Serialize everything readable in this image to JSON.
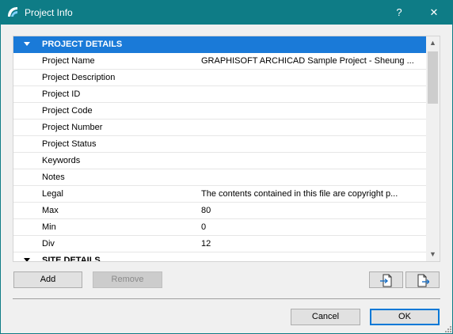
{
  "window": {
    "title": "Project Info",
    "help_label": "?",
    "close_label": "✕",
    "accent_color": "#0e7c86"
  },
  "list": {
    "sections": [
      {
        "title": "PROJECT DETAILS",
        "expanded": true,
        "rows": [
          {
            "key": "Project Name",
            "value": "GRAPHISOFT ARCHICAD Sample Project - Sheung ..."
          },
          {
            "key": "Project Description",
            "value": ""
          },
          {
            "key": "Project ID",
            "value": ""
          },
          {
            "key": "Project Code",
            "value": ""
          },
          {
            "key": "Project Number",
            "value": ""
          },
          {
            "key": "Project Status",
            "value": ""
          },
          {
            "key": "Keywords",
            "value": ""
          },
          {
            "key": "Notes",
            "value": ""
          },
          {
            "key": "Legal",
            "value": "The contents contained in this file are copyright p..."
          },
          {
            "key": "Max",
            "value": "80"
          },
          {
            "key": "Min",
            "value": "0"
          },
          {
            "key": "Div",
            "value": "12"
          }
        ]
      },
      {
        "title": "SITE DETAILS",
        "expanded": true,
        "rows": []
      }
    ],
    "selected_header_color": "#1a7ad8"
  },
  "buttons": {
    "add_label": "Add",
    "remove_label": "Remove",
    "import_icon": "import-file-icon",
    "export_icon": "export-file-icon",
    "cancel_label": "Cancel",
    "ok_label": "OK"
  }
}
